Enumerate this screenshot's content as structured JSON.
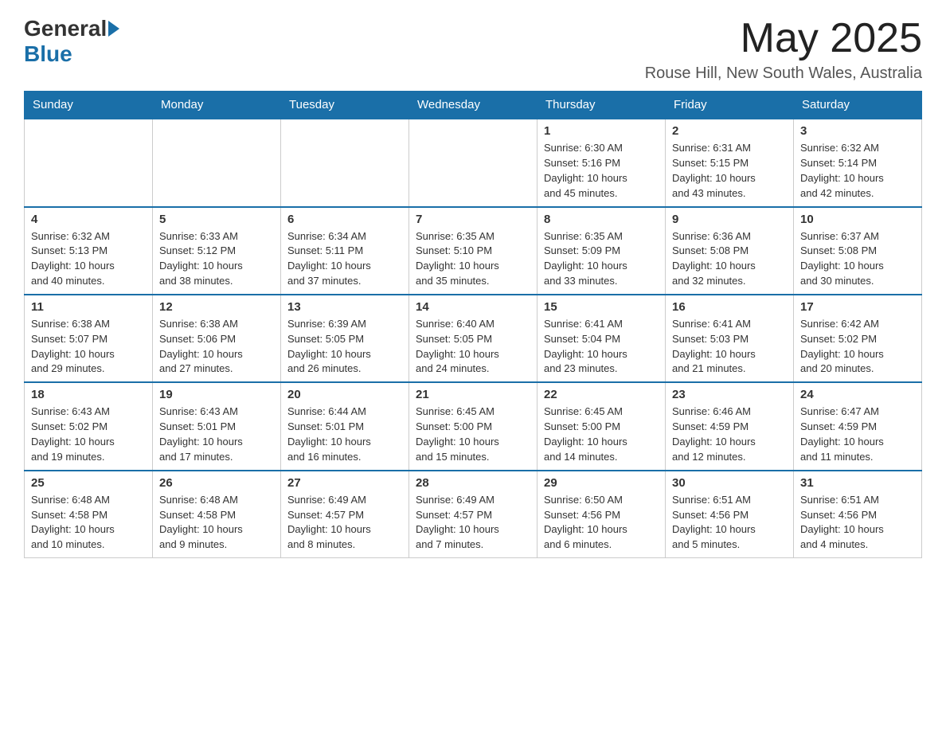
{
  "header": {
    "logo_general": "General",
    "logo_blue": "Blue",
    "month": "May 2025",
    "location": "Rouse Hill, New South Wales, Australia"
  },
  "days_of_week": [
    "Sunday",
    "Monday",
    "Tuesday",
    "Wednesday",
    "Thursday",
    "Friday",
    "Saturday"
  ],
  "weeks": [
    [
      {
        "day": "",
        "info": ""
      },
      {
        "day": "",
        "info": ""
      },
      {
        "day": "",
        "info": ""
      },
      {
        "day": "",
        "info": ""
      },
      {
        "day": "1",
        "info": "Sunrise: 6:30 AM\nSunset: 5:16 PM\nDaylight: 10 hours\nand 45 minutes."
      },
      {
        "day": "2",
        "info": "Sunrise: 6:31 AM\nSunset: 5:15 PM\nDaylight: 10 hours\nand 43 minutes."
      },
      {
        "day": "3",
        "info": "Sunrise: 6:32 AM\nSunset: 5:14 PM\nDaylight: 10 hours\nand 42 minutes."
      }
    ],
    [
      {
        "day": "4",
        "info": "Sunrise: 6:32 AM\nSunset: 5:13 PM\nDaylight: 10 hours\nand 40 minutes."
      },
      {
        "day": "5",
        "info": "Sunrise: 6:33 AM\nSunset: 5:12 PM\nDaylight: 10 hours\nand 38 minutes."
      },
      {
        "day": "6",
        "info": "Sunrise: 6:34 AM\nSunset: 5:11 PM\nDaylight: 10 hours\nand 37 minutes."
      },
      {
        "day": "7",
        "info": "Sunrise: 6:35 AM\nSunset: 5:10 PM\nDaylight: 10 hours\nand 35 minutes."
      },
      {
        "day": "8",
        "info": "Sunrise: 6:35 AM\nSunset: 5:09 PM\nDaylight: 10 hours\nand 33 minutes."
      },
      {
        "day": "9",
        "info": "Sunrise: 6:36 AM\nSunset: 5:08 PM\nDaylight: 10 hours\nand 32 minutes."
      },
      {
        "day": "10",
        "info": "Sunrise: 6:37 AM\nSunset: 5:08 PM\nDaylight: 10 hours\nand 30 minutes."
      }
    ],
    [
      {
        "day": "11",
        "info": "Sunrise: 6:38 AM\nSunset: 5:07 PM\nDaylight: 10 hours\nand 29 minutes."
      },
      {
        "day": "12",
        "info": "Sunrise: 6:38 AM\nSunset: 5:06 PM\nDaylight: 10 hours\nand 27 minutes."
      },
      {
        "day": "13",
        "info": "Sunrise: 6:39 AM\nSunset: 5:05 PM\nDaylight: 10 hours\nand 26 minutes."
      },
      {
        "day": "14",
        "info": "Sunrise: 6:40 AM\nSunset: 5:05 PM\nDaylight: 10 hours\nand 24 minutes."
      },
      {
        "day": "15",
        "info": "Sunrise: 6:41 AM\nSunset: 5:04 PM\nDaylight: 10 hours\nand 23 minutes."
      },
      {
        "day": "16",
        "info": "Sunrise: 6:41 AM\nSunset: 5:03 PM\nDaylight: 10 hours\nand 21 minutes."
      },
      {
        "day": "17",
        "info": "Sunrise: 6:42 AM\nSunset: 5:02 PM\nDaylight: 10 hours\nand 20 minutes."
      }
    ],
    [
      {
        "day": "18",
        "info": "Sunrise: 6:43 AM\nSunset: 5:02 PM\nDaylight: 10 hours\nand 19 minutes."
      },
      {
        "day": "19",
        "info": "Sunrise: 6:43 AM\nSunset: 5:01 PM\nDaylight: 10 hours\nand 17 minutes."
      },
      {
        "day": "20",
        "info": "Sunrise: 6:44 AM\nSunset: 5:01 PM\nDaylight: 10 hours\nand 16 minutes."
      },
      {
        "day": "21",
        "info": "Sunrise: 6:45 AM\nSunset: 5:00 PM\nDaylight: 10 hours\nand 15 minutes."
      },
      {
        "day": "22",
        "info": "Sunrise: 6:45 AM\nSunset: 5:00 PM\nDaylight: 10 hours\nand 14 minutes."
      },
      {
        "day": "23",
        "info": "Sunrise: 6:46 AM\nSunset: 4:59 PM\nDaylight: 10 hours\nand 12 minutes."
      },
      {
        "day": "24",
        "info": "Sunrise: 6:47 AM\nSunset: 4:59 PM\nDaylight: 10 hours\nand 11 minutes."
      }
    ],
    [
      {
        "day": "25",
        "info": "Sunrise: 6:48 AM\nSunset: 4:58 PM\nDaylight: 10 hours\nand 10 minutes."
      },
      {
        "day": "26",
        "info": "Sunrise: 6:48 AM\nSunset: 4:58 PM\nDaylight: 10 hours\nand 9 minutes."
      },
      {
        "day": "27",
        "info": "Sunrise: 6:49 AM\nSunset: 4:57 PM\nDaylight: 10 hours\nand 8 minutes."
      },
      {
        "day": "28",
        "info": "Sunrise: 6:49 AM\nSunset: 4:57 PM\nDaylight: 10 hours\nand 7 minutes."
      },
      {
        "day": "29",
        "info": "Sunrise: 6:50 AM\nSunset: 4:56 PM\nDaylight: 10 hours\nand 6 minutes."
      },
      {
        "day": "30",
        "info": "Sunrise: 6:51 AM\nSunset: 4:56 PM\nDaylight: 10 hours\nand 5 minutes."
      },
      {
        "day": "31",
        "info": "Sunrise: 6:51 AM\nSunset: 4:56 PM\nDaylight: 10 hours\nand 4 minutes."
      }
    ]
  ]
}
